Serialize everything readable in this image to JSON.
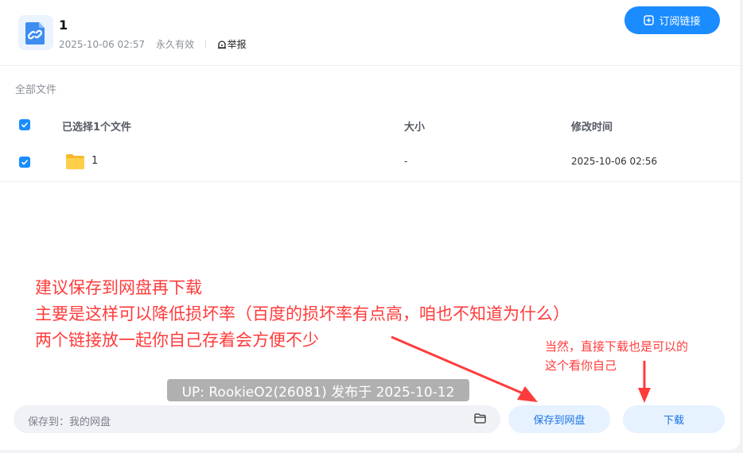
{
  "share": {
    "title": "1",
    "date": "2025-10-06 02:57",
    "validity": "永久有效",
    "report_label": "举报"
  },
  "subscribe_button": {
    "label": "订阅链接",
    "icon": "plus-square-icon"
  },
  "breadcrumb": "全部文件",
  "table": {
    "headers": {
      "name": "已选择1个文件",
      "size": "大小",
      "modified": "修改时间"
    },
    "rows": [
      {
        "name": "1",
        "size": "-",
        "modified": "2025-10-06 02:56",
        "icon": "folder-icon",
        "checked": true
      }
    ]
  },
  "save_to": {
    "label": "保存到：我的网盘",
    "icon": "folder-outline-icon"
  },
  "buttons": {
    "save_label": "保存到网盘",
    "download_label": "下载"
  },
  "annotations": {
    "main_lines": [
      "建议保存到网盘再下载",
      "主要是这样可以降低损坏率（百度的损坏率有点高，咱也不知道为什么）",
      "两个链接放一起你自己存着会方便不少"
    ],
    "side_lines": [
      "当然，直接下载也是可以的",
      "这个看你自己"
    ]
  },
  "watermark": "UP: RookieO2(26081) 发布于 2025-10-12",
  "colors": {
    "accent": "#1a8cff",
    "annotation": "#ff3b3b",
    "pill_bg": "#e6f2ff"
  }
}
